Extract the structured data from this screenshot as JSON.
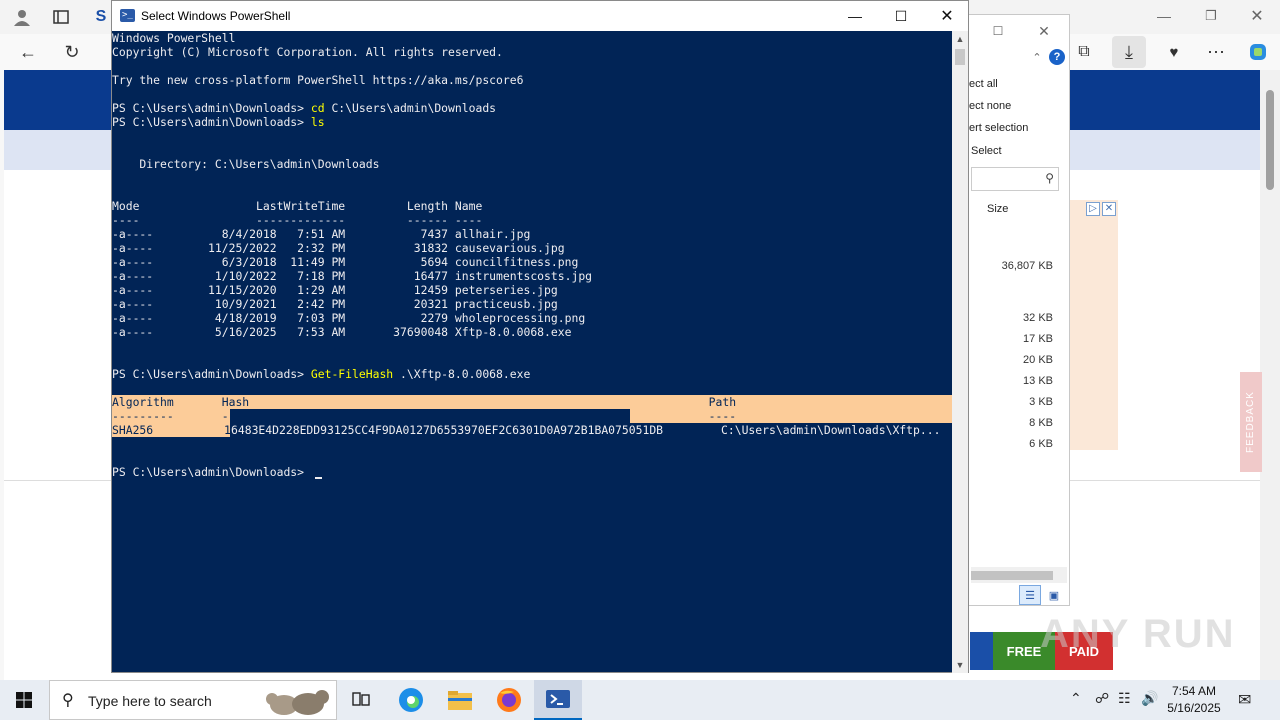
{
  "powershell": {
    "title": "Select Windows PowerShell",
    "lines": [
      {
        "row": 0,
        "text": "Windows PowerShell"
      },
      {
        "row": 1,
        "text": "Copyright (C) Microsoft Corporation. All rights reserved."
      },
      {
        "row": 3,
        "text": "Try the new cross-platform PowerShell https://aka.ms/pscore6"
      },
      {
        "row": 5,
        "prompt": "PS C:\\Users\\admin\\Downloads> ",
        "cmd": "cd",
        "args": " C:\\Users\\admin\\Downloads"
      },
      {
        "row": 6,
        "prompt": "PS C:\\Users\\admin\\Downloads> ",
        "cmd": "ls",
        "args": ""
      },
      {
        "row": 9,
        "text": "    Directory: C:\\Users\\admin\\Downloads"
      },
      {
        "row": 12,
        "text": "Mode                 LastWriteTime         Length Name"
      },
      {
        "row": 13,
        "text": "----                 -------------         ------ ----"
      },
      {
        "row": 14,
        "text": "-a----          8/4/2018   7:51 AM           7437 allhair.jpg"
      },
      {
        "row": 15,
        "text": "-a----        11/25/2022   2:32 PM          31832 causevarious.jpg"
      },
      {
        "row": 16,
        "text": "-a----          6/3/2018  11:49 PM           5694 councilfitness.png"
      },
      {
        "row": 17,
        "text": "-a----         1/10/2022   7:18 PM          16477 instrumentscosts.jpg"
      },
      {
        "row": 18,
        "text": "-a----        11/15/2020   1:29 AM          12459 peterseries.jpg"
      },
      {
        "row": 19,
        "text": "-a----         10/9/2021   2:42 PM          20321 practiceusb.jpg"
      },
      {
        "row": 20,
        "text": "-a----         4/18/2019   7:03 PM           2279 wholeprocessing.png"
      },
      {
        "row": 21,
        "text": "-a----         5/16/2025   7:53 AM       37690048 Xftp-8.0.0068.exe"
      },
      {
        "row": 24,
        "prompt": "PS C:\\Users\\admin\\Downloads> ",
        "cmd": "Get-FileHash",
        "args": " .\\Xftp-8.0.0068.exe"
      },
      {
        "row": 31,
        "text": "PS C:\\Users\\admin\\Downloads>"
      }
    ],
    "hash_table": {
      "header": "Algorithm       Hash                                                                   Path",
      "dashes": "---------       ----                                                                   ----",
      "algorithm": "SHA256",
      "hash_first": "1",
      "hash_rest": "6483E4D228EDD93125CC4F9DA0127D6553970EF2C6301D0A972B1BA075051DB",
      "path": "C:\\Users\\admin\\Downloads\\Xftp..."
    }
  },
  "explorer": {
    "menu": [
      "ect all",
      "ect none",
      "ert selection"
    ],
    "select_label": "Select",
    "column_size": "Size",
    "sizes": [
      "36,807 KB",
      "32 KB",
      "17 KB",
      "20 KB",
      "13 KB",
      "3 KB",
      "8 KB",
      "6 KB"
    ]
  },
  "browser": {
    "feedback": "FEEDBACK",
    "free": "FREE",
    "paid": "PAID",
    "watermark": "ANY RUN"
  },
  "taskbar": {
    "search_placeholder": "Type here to search",
    "time": "7:54 AM",
    "date": "5/16/2025"
  }
}
